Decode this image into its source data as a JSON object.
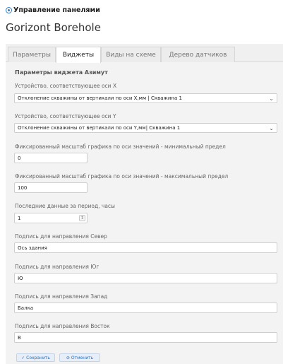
{
  "header": {
    "title": "Управление панелями"
  },
  "app": {
    "title": "Gorizont Borehole"
  },
  "tabs": [
    {
      "label": "Параметры"
    },
    {
      "label": "Виджеты"
    },
    {
      "label": "Виды на схеме"
    },
    {
      "label": "Дерево датчиков"
    }
  ],
  "form": {
    "section_title": "Параметры виджета Азимут",
    "axis_x_label": "Устройство, соответствующее оси X",
    "axis_x_value": "Отклонение скважины от вертикали по оси X,мм | Скважина 1",
    "axis_y_label": "Устройство, соответствующее оси Y",
    "axis_y_value": "Отклонение скважины от вертикали по оси Y,мм| Скважина 1",
    "scale_min_label": "Фиксированный масштаб графика по оси значений - минимальный предел",
    "scale_min_value": "0",
    "scale_max_label": "Фиксированный масштаб графика по оси значений - максимальный предел",
    "scale_max_value": "100",
    "period_label": "Последние данные за период, часы",
    "period_value": "1",
    "north_label": "Подпись для направления Север",
    "north_value": "Ось здания",
    "south_label": "Подпись для направления Юг",
    "south_value": "Ю",
    "west_label": "Подпись для направления Запад",
    "west_value": "Балка",
    "east_label": "Подпись для направления Восток",
    "east_value": "В"
  },
  "actions": {
    "save_label": "Сохранить",
    "cancel_label": "Отменить"
  },
  "icons": {
    "header": "circle-dot-icon",
    "select": "chevron-down-icon",
    "stepper": "stepper-icon",
    "save": "check-icon",
    "cancel": "cancel-icon"
  },
  "colors": {
    "accent": "#2a7fd4",
    "panel_bg": "#f3f3f3",
    "button_bg": "#e7eef8",
    "button_text": "#2a6fb8"
  }
}
